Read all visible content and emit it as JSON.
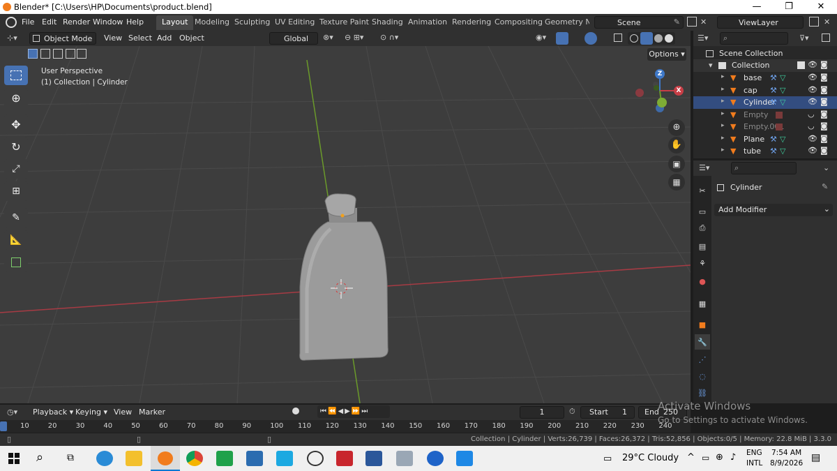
{
  "window": {
    "title": "Blender* [C:\\Users\\HP\\Documents\\product.blend]",
    "min": "—",
    "max": "❐",
    "close": "✕"
  },
  "menu": [
    "File",
    "Edit",
    "Render",
    "Window",
    "Help"
  ],
  "workspaces": [
    "Layout",
    "Modeling",
    "Sculpting",
    "UV Editing",
    "Texture Paint",
    "Shading",
    "Animation",
    "Rendering",
    "Compositing",
    "Geometry Noc"
  ],
  "scene": "Scene",
  "view_layer": "ViewLayer",
  "header": {
    "mode": "Object Mode",
    "view": "View",
    "select": "Select",
    "add": "Add",
    "object": "Object",
    "orientation": "Global",
    "options": "Options"
  },
  "overlay": {
    "line1": "User Perspective",
    "line2": "(1) Collection | Cylinder"
  },
  "gizmo": {
    "z": "Z",
    "x": "X"
  },
  "outliner": {
    "scene_collection": "Scene Collection",
    "collection": "Collection",
    "items": [
      "base",
      "cap",
      "Cylinder",
      "Empty",
      "Empty.001",
      "Plane",
      "tube"
    ]
  },
  "properties": {
    "object": "Cylinder",
    "add_modifier": "Add Modifier"
  },
  "timeline": {
    "playback": "Playback",
    "keying": "Keying",
    "view": "View",
    "marker": "Marker",
    "current_frame": "1",
    "start_label": "Start",
    "start": "1",
    "end_label": "End",
    "end": "250",
    "ticks": [
      "10",
      "20",
      "30",
      "40",
      "50",
      "60",
      "70",
      "80",
      "90",
      "100",
      "110",
      "120",
      "130",
      "140",
      "150",
      "160",
      "170",
      "180",
      "190",
      "200",
      "210",
      "220",
      "230",
      "240"
    ]
  },
  "activate": {
    "line1": "Activate Windows",
    "line2": "Go to Settings to activate Windows."
  },
  "status": "Collection | Cylinder | Verts:26,739 | Faces:26,372 | Tris:52,856 | Objects:0/5 | Memory: 22.8 MiB | 3.3.0",
  "taskbar": {
    "weather": "29°C  Cloudy",
    "lang1": "ENG",
    "lang2": "INTL",
    "time": "7:54 AM",
    "date": "8/9/2026"
  },
  "colors": {
    "accent": "#4772b3",
    "orange": "#f17c1d",
    "viewport": "#3d3d3d",
    "grid": "#4a4a4a",
    "xaxis": "#a73b44",
    "yaxis": "#6b9a2a"
  }
}
